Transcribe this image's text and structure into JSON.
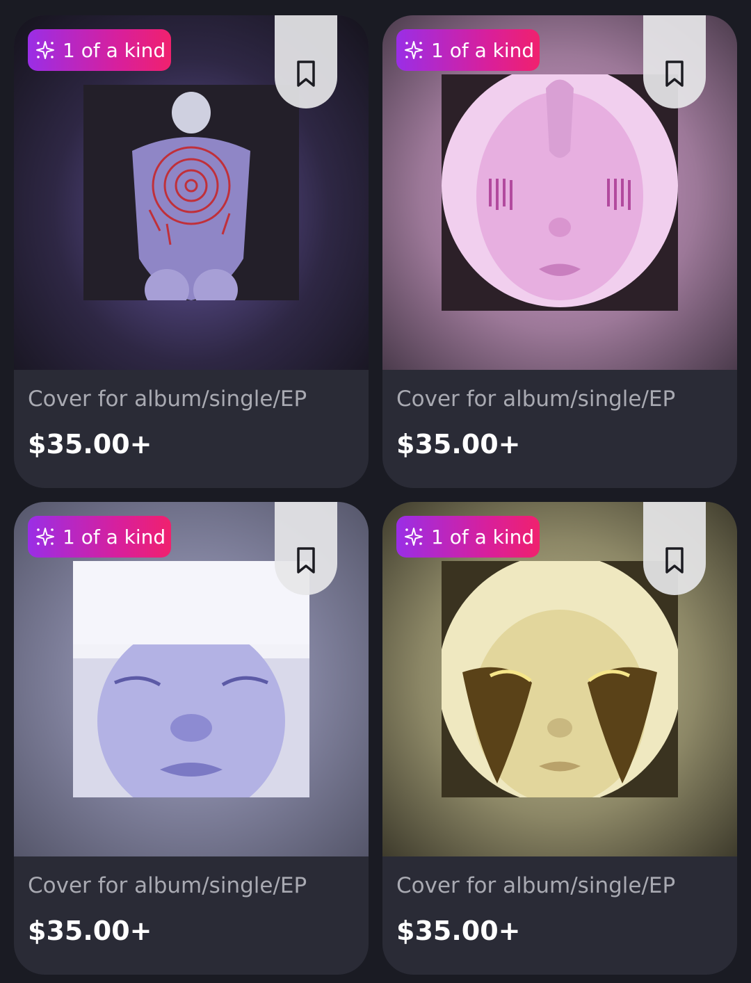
{
  "listings": [
    {
      "badge": "1 of a kind",
      "title": "Cover for album/single/EP",
      "price": "$35.00+",
      "art_theme": "purple-back",
      "accent": "#7a66c0"
    },
    {
      "badge": "1 of a kind",
      "title": "Cover for album/single/EP",
      "price": "$35.00+",
      "art_theme": "pink-face",
      "accent": "#e9b6e6"
    },
    {
      "badge": "1 of a kind",
      "title": "Cover for album/single/EP",
      "price": "$35.00+",
      "art_theme": "lavender-face",
      "accent": "#b9b7e6"
    },
    {
      "badge": "1 of a kind",
      "title": "Cover for album/single/EP",
      "price": "$35.00+",
      "art_theme": "gold-face",
      "accent": "#e8dfae"
    }
  ],
  "colors": {
    "background": "#1a1b23",
    "card": "#2a2b36",
    "badge_gradient_start": "#9a2ee6",
    "badge_gradient_end": "#f0216e"
  },
  "icons": {
    "badge_icon": "sparkle-icon",
    "save_icon": "bookmark-icon"
  }
}
